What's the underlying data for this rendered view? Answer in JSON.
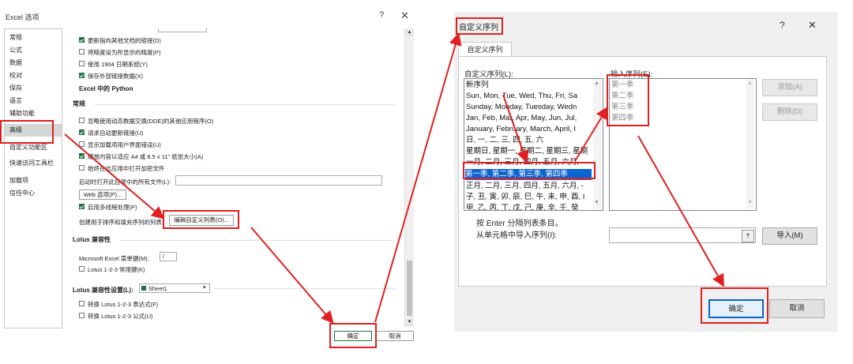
{
  "left": {
    "title": "Excel 选项",
    "help": "?",
    "close": "✕",
    "nav": [
      "常规",
      "公式",
      "数据",
      "校对",
      "保存",
      "语言",
      "辅助功能",
      "高级",
      "自定义功能区",
      "快速访问工具栏",
      "加载项",
      "信任中心"
    ],
    "selected_nav": "高级",
    "rows_top": [
      {
        "label": "更新指向其他文档的链接(D)",
        "checked": true
      },
      {
        "label": "将精度设为所显示的精度(P)",
        "checked": false
      },
      {
        "label": "使用 1904 日期系统(Y)",
        "checked": false
      },
      {
        "label": "保存外部链接数据(X)",
        "checked": true
      }
    ],
    "python_heading": "Excel 中的 Python",
    "general_heading": "常规",
    "rows_general": [
      {
        "label": "忽略使用动态数据交换(DDE)的其他应用程序(O)",
        "checked": false
      },
      {
        "label": "请求自动更新链接(U)",
        "checked": true
      },
      {
        "label": "显示加载项用户界面错误(U)",
        "checked": false
      },
      {
        "label": "缩放内容以适应 A4 或 8.5 x 11\" 纸张大小(A)",
        "checked": true
      },
      {
        "label": "始终在此应用中打开加密文件",
        "checked": false
      }
    ],
    "open_files_label": "启动时打开此目录中的所有文件(L):",
    "web_options_button": "Web 选项(P)...",
    "multithread_label": "启用多线程处理(P)",
    "multithread_checked": true,
    "custom_list_label": "创建用于排序和填充序列的列表:",
    "edit_custom_list_button": "编辑自定义列表(O)...",
    "lotus_heading": "Lotus 兼容性",
    "menu_key_label": "Microsoft Excel 菜单键(M):",
    "menu_key_value": "/",
    "lotus_nav_label": "Lotus 1-2-3 常用键(K)",
    "lotus_settings_label": "Lotus 兼容性设置(L):",
    "sheet_value": "Sheet1",
    "lotus_eval_label": "转换 Lotus 1-2-3 表达式(F)",
    "lotus_formula_label": "转换 Lotus 1-2-3 公式(U)",
    "ok": "确定",
    "cancel": "取消"
  },
  "right": {
    "title": "自定义序列",
    "help": "?",
    "close": "✕",
    "tab": "自定义序列",
    "lists_label": "自定义序列(L):",
    "lists": [
      "新序列",
      "Sun, Mon, Tue, Wed, Thu, Fri, Sa",
      "Sunday, Monday, Tuesday, Wedn",
      "Jan, Feb, Mar, Apr, May, Jun, Jul,",
      "January, February, March, April, I",
      "日, 一, 二, 三, 四, 五, 六",
      "星期日, 星期一, 星期二, 星期三, 星期",
      "一月, 二月, 三月, 四月, 五月, 六月, -",
      "第一季, 第二季, 第三季, 第四季",
      "正月, 二月, 三月, 四月, 五月, 六月, -",
      "子, 丑, 寅, 卯, 辰, 巳, 午, 未, 申, 酉, I",
      "甲, 乙, 丙, 丁, 戊, 己, 庚, 辛, 壬, 癸"
    ],
    "selected_index": 8,
    "entries_label": "输入序列(E):",
    "entries": [
      "第一季",
      "第二季",
      "第三季",
      "第四季"
    ],
    "add_button": "添加(A)",
    "delete_button": "删除(D)",
    "hint": "按 Enter 分隔列表条目。",
    "import_label": "从单元格中导入序列(I):",
    "import_button": "导入(M)",
    "ok": "确定",
    "cancel": "取消"
  },
  "colors": {
    "highlight": "#e02020",
    "selection": "#0a64d2",
    "excel_green": "#217346"
  }
}
